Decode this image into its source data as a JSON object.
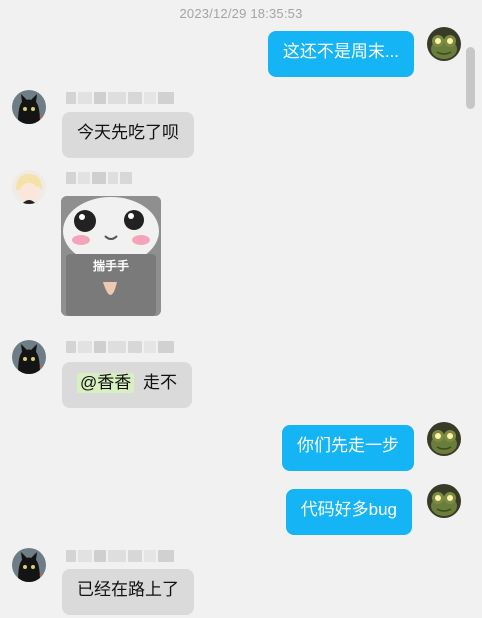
{
  "timestamp": "2023/12/29 18:35:53",
  "messages": [
    {
      "side": "right",
      "sender": "frog",
      "text": "这还不是周末..."
    },
    {
      "side": "left",
      "sender": "black-cat",
      "text": "今天先吃了呗"
    },
    {
      "side": "left",
      "sender": "anime-boy",
      "type": "image",
      "caption": "揣手手"
    },
    {
      "side": "left",
      "sender": "black-cat",
      "mention": "@香香",
      "text": "走不"
    },
    {
      "side": "right",
      "sender": "frog",
      "text": "你们先走一步"
    },
    {
      "side": "right",
      "sender": "frog",
      "text": "代码好多bug"
    },
    {
      "side": "left",
      "sender": "black-cat",
      "text": "已经在路上了"
    }
  ],
  "colors": {
    "background": "#f1f1f1",
    "left_bubble": "#dadada",
    "right_bubble": "#14b4f5",
    "mention_highlight": "#d8efc1",
    "timestamp_text": "#a4a4a4"
  }
}
